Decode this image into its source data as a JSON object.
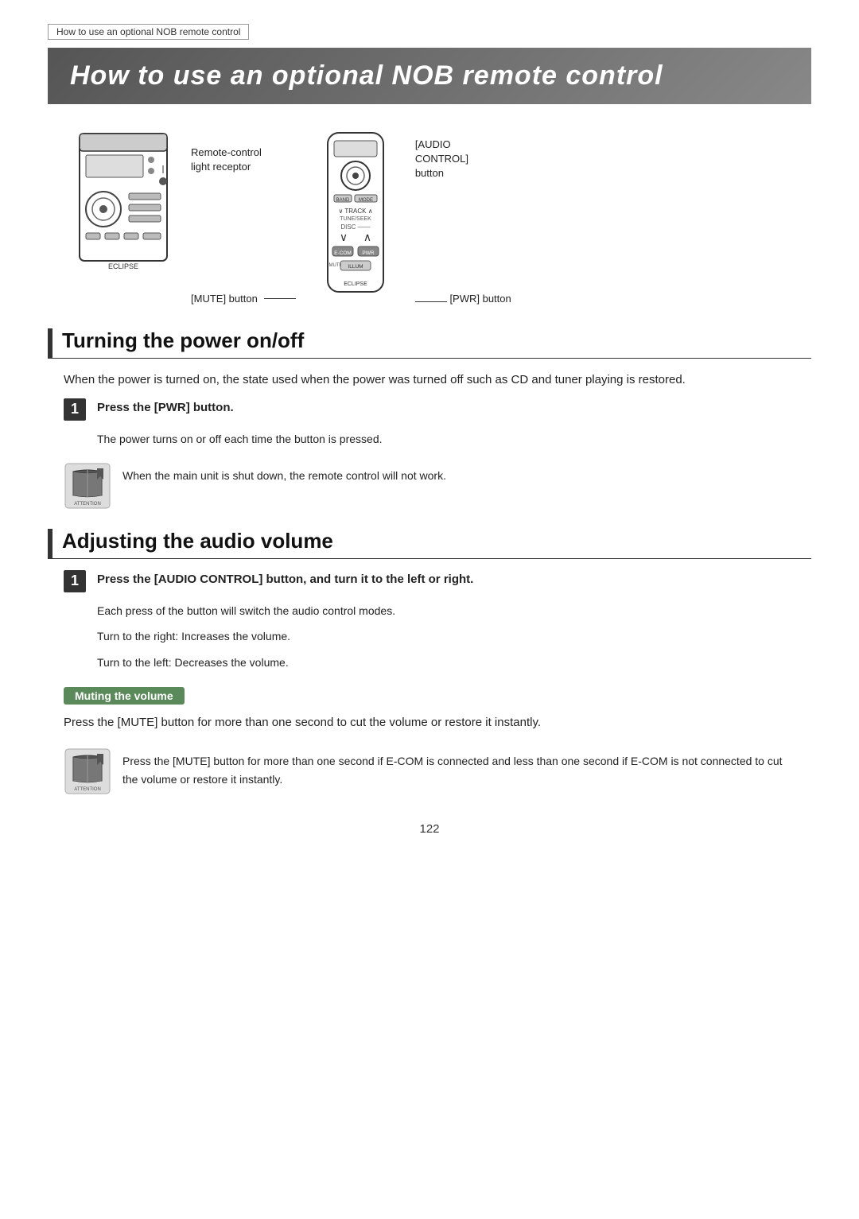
{
  "breadcrumb": "How to use an optional NOB remote control",
  "title": "How to use an optional NOB remote control",
  "diagram": {
    "remote_control_light_receptor": "Remote-control\nlight receptor",
    "mute_button_label": "[MUTE] button",
    "audio_control_label": "[AUDIO\nCONTROL]\nbutton",
    "pwr_button_label": "[PWR] button"
  },
  "section1": {
    "heading": "Turning the power on/off",
    "intro": "When the power is turned on, the state used when the power was turned off such as CD and tuner playing is restored.",
    "step1_label": "1",
    "step1_text": "Press the [PWR] button.",
    "step1_sub": "The power turns on or off each time the button is pressed.",
    "attention1": "When the main unit is shut down, the remote control will not work."
  },
  "section2": {
    "heading": "Adjusting the audio volume",
    "step1_label": "1",
    "step1_text": "Press the [AUDIO CONTROL] button, and turn it to the left or right.",
    "step1_sub1": "Each press of the button will switch the audio control modes.",
    "step1_sub2": "Turn to the right:   Increases the volume.",
    "step1_sub3": "Turn to the left:     Decreases the volume.",
    "sub_section_badge": "Muting the volume",
    "mute_para": "Press the [MUTE] button for more than one second to cut the volume or restore it instantly.",
    "attention2": "Press the [MUTE] button for more than one second if E-COM is connected and less than one second if E-COM is not connected to cut the volume or restore it instantly."
  },
  "page_number": "122"
}
